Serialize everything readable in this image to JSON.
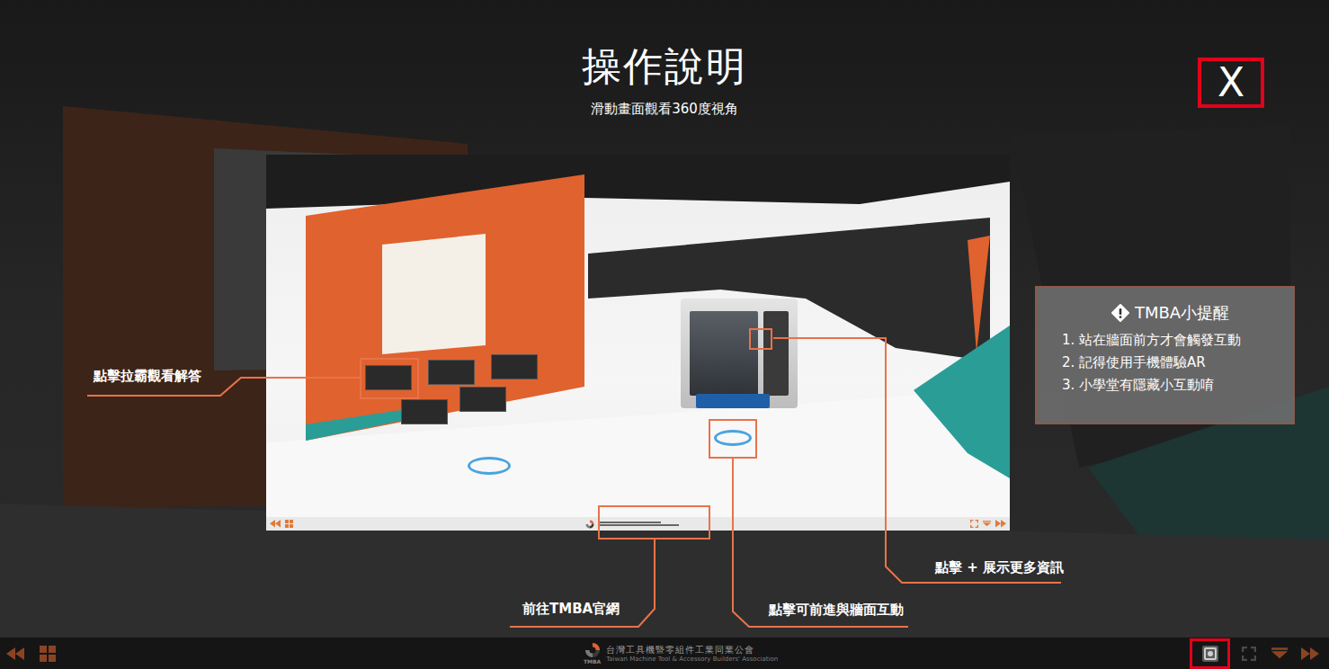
{
  "title": "操作說明",
  "subtitle": "滑動畫面觀看360度視角",
  "close_button": {
    "label": "X"
  },
  "callouts": [
    {
      "label": "點擊拉霸觀看解答"
    },
    {
      "label": "前往TMBA官網"
    },
    {
      "label": "點擊可前進與牆面互動"
    },
    {
      "label": "點擊 + 展示更多資訊"
    }
  ],
  "tips": {
    "title": "TMBA小提醒",
    "items": [
      "1. 站在牆面前方才會觸發互動",
      "2. 記得使用手機體驗AR",
      "3. 小學堂有隱藏小互動唷"
    ]
  },
  "footer": {
    "org_name": "台灣工具機暨零組件工業同業公會",
    "org_english": "Taiwan Machine Tool & Accessory Builders' Association",
    "logo_text": "TMBA",
    "active_tool": "screenshot"
  }
}
